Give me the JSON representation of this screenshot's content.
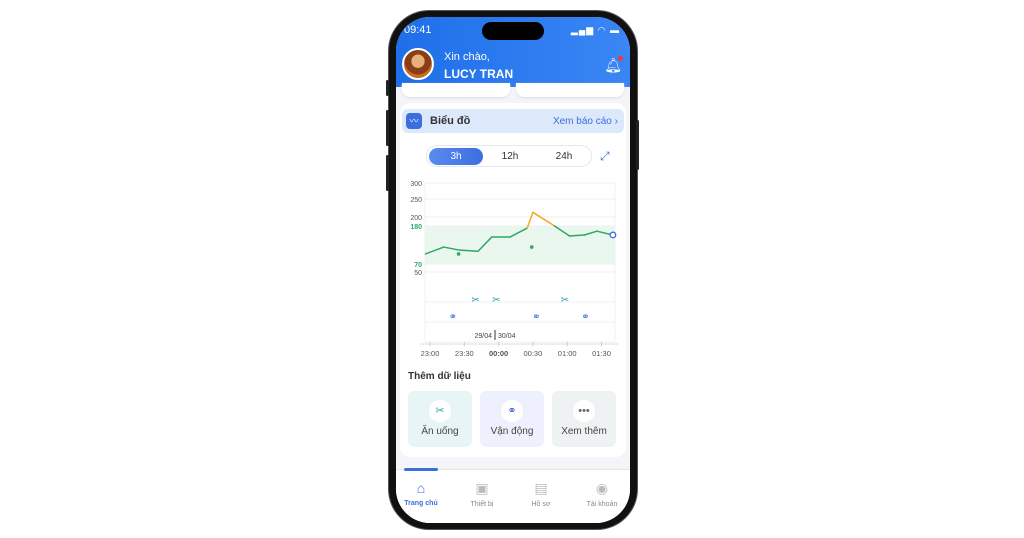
{
  "status": {
    "time": "09:41"
  },
  "header": {
    "greeting": "Xin chào,",
    "user_name": "LUCY TRAN"
  },
  "chart_card": {
    "title": "Biểu đồ",
    "report_link": "Xem báo cáo",
    "ranges": [
      "3h",
      "12h",
      "24h"
    ],
    "selected_range": "3h"
  },
  "chart_data": {
    "type": "line",
    "y_ticks": [
      300,
      250,
      200,
      180,
      70,
      50
    ],
    "target_range": [
      70,
      180
    ],
    "x_ticks": [
      "23:00",
      "23:30",
      "00:00",
      "00:30",
      "01:00",
      "01:30"
    ],
    "bold_tick": "00:00",
    "date_labels": [
      "29/04",
      "30/04"
    ],
    "series": [
      {
        "points": [
          [
            "22:56",
            99
          ],
          [
            "23:12",
            119
          ],
          [
            "23:26",
            110
          ],
          [
            "23:42",
            107
          ],
          [
            "23:54",
            148
          ],
          [
            "00:10",
            148
          ],
          [
            "00:25",
            174
          ],
          [
            "00:30",
            213
          ],
          [
            "00:49",
            180
          ],
          [
            "01:02",
            151
          ],
          [
            "01:15",
            154
          ],
          [
            "01:26",
            165
          ],
          [
            "01:40",
            154
          ]
        ]
      }
    ],
    "markers": [
      [
        "23:25",
        99
      ],
      [
        "00:29",
        119
      ]
    ],
    "meal_events": [
      "23:40",
      "23:58",
      "00:58"
    ],
    "exercise_events": [
      "23:20",
      "00:33",
      "01:16"
    ],
    "colors": {
      "in_range": "#2fa864",
      "high": "#f5a623",
      "target_band": "#e9f7ef",
      "target_label": "#2fa864",
      "current_point": "#3d6ee0"
    }
  },
  "add_data": {
    "title": "Thêm dữ liệu",
    "tiles": [
      {
        "label": "Ăn uống",
        "icon": "fork-spoon-icon"
      },
      {
        "label": "Vận động",
        "icon": "dumbbell-icon"
      },
      {
        "label": "Xem thêm",
        "icon": "more-icon"
      }
    ]
  },
  "nav": {
    "items": [
      {
        "label": "Trang chủ",
        "icon": "home-icon"
      },
      {
        "label": "Thiết bị",
        "icon": "device-icon"
      },
      {
        "label": "Hồ sơ",
        "icon": "clipboard-icon"
      },
      {
        "label": "Tài khoản",
        "icon": "account-icon"
      }
    ],
    "active": "Trang chủ"
  }
}
